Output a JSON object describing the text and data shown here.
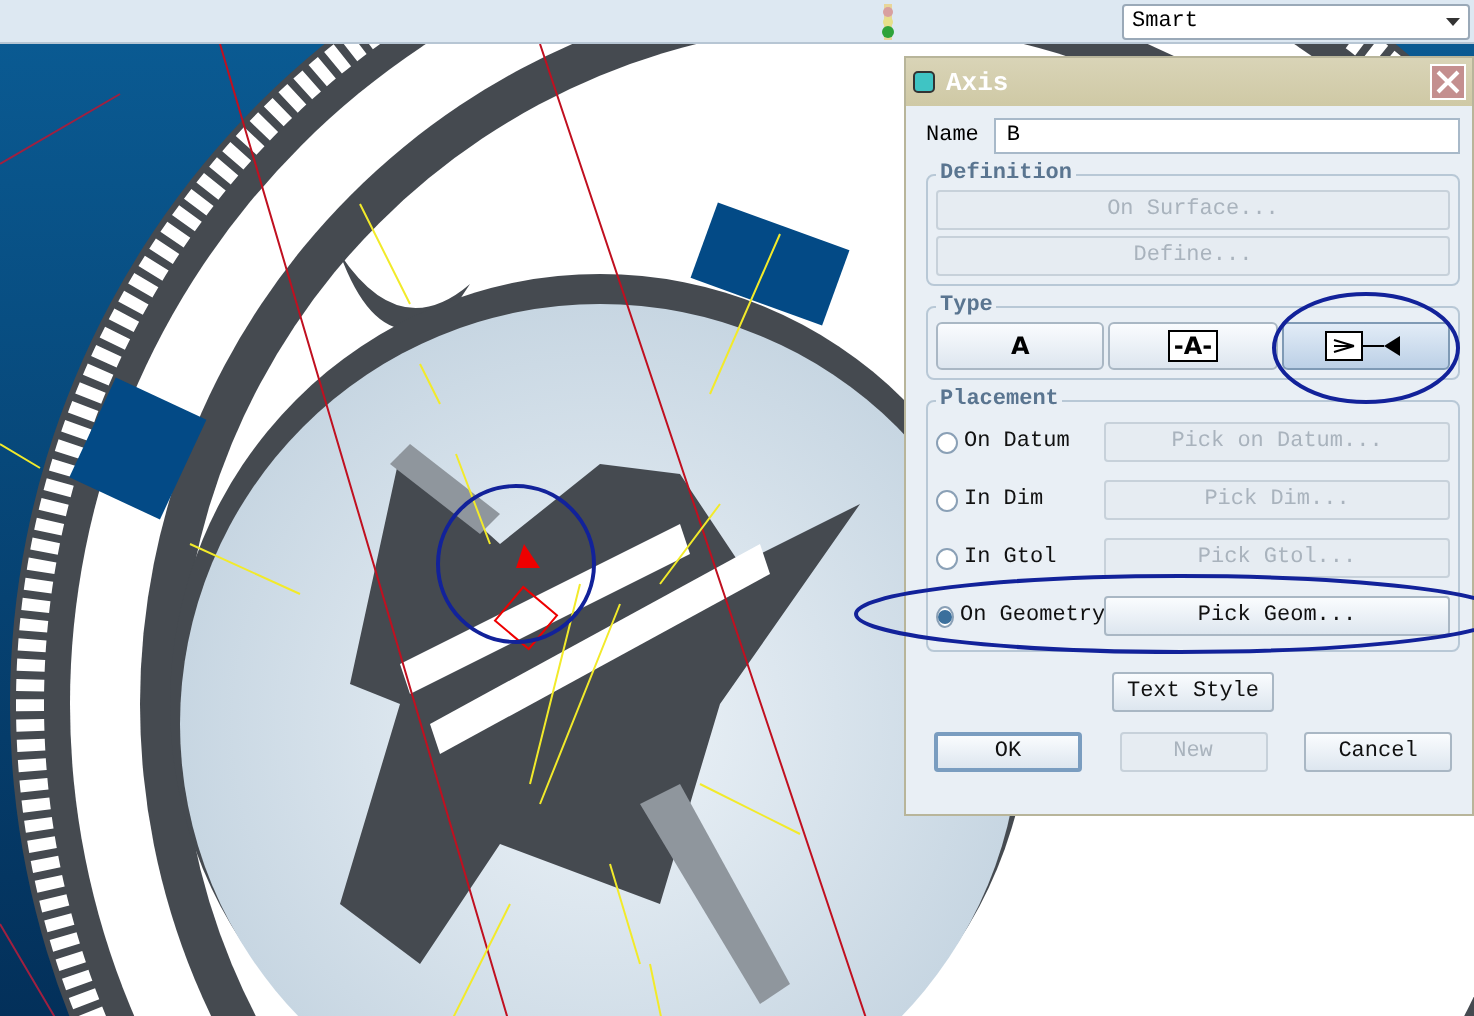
{
  "toolbar": {
    "filter": {
      "value": "Smart"
    }
  },
  "dialog": {
    "title": "Axis",
    "name_label": "Name",
    "name_value": "B",
    "definition": {
      "title": "Definition",
      "buttons": [
        {
          "label": "On Surface...",
          "disabled": true
        },
        {
          "label": "Define...",
          "disabled": true
        }
      ]
    },
    "type": {
      "title": "Type",
      "options": [
        {
          "kind": "text",
          "label": "A",
          "selected": false
        },
        {
          "kind": "boxed",
          "label": "-A-",
          "selected": false
        },
        {
          "kind": "icon",
          "selected": true
        }
      ]
    },
    "placement": {
      "title": "Placement",
      "options": [
        {
          "label": "On Datum",
          "selected": false,
          "button": "Pick on Datum...",
          "button_disabled": true
        },
        {
          "label": "In Dim",
          "selected": false,
          "button": "Pick Dim...",
          "button_disabled": true
        },
        {
          "label": "In Gtol",
          "selected": false,
          "button": "Pick Gtol...",
          "button_disabled": true
        },
        {
          "label": "On Geometry",
          "selected": true,
          "button": "Pick Geom...",
          "button_disabled": false
        }
      ]
    },
    "text_style_button": "Text Style",
    "buttons": [
      {
        "label": "OK",
        "kind": "default",
        "disabled": false
      },
      {
        "label": "New",
        "kind": "normal",
        "disabled": true
      },
      {
        "label": "Cancel",
        "kind": "normal",
        "disabled": false
      }
    ]
  }
}
